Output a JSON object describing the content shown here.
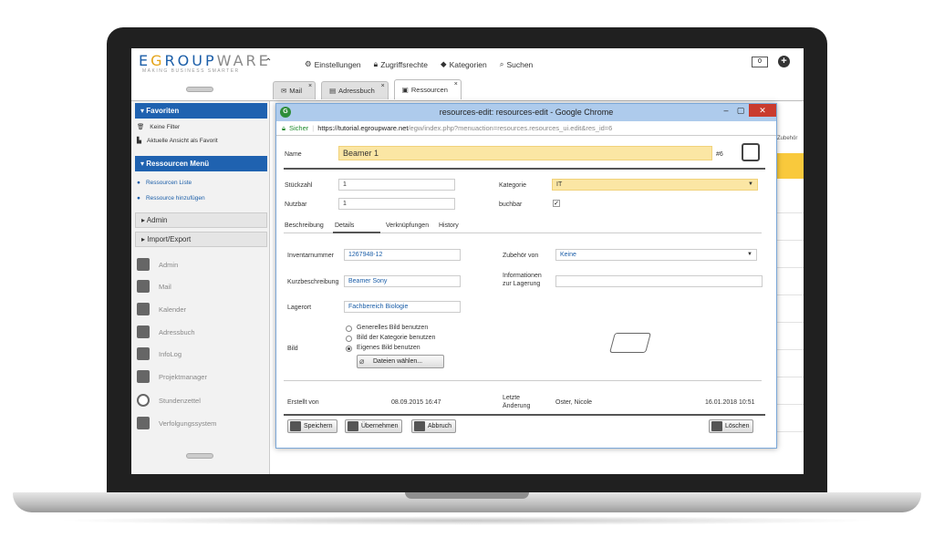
{
  "header": {
    "logo": "EGROUPWARE",
    "logo_sub": "MAKING BUSINESS SMARTER",
    "nav": [
      "Einstellungen",
      "Zugriffsrechte",
      "Kategorien",
      "Suchen"
    ],
    "counter": "0"
  },
  "tabs": [
    {
      "label": "Mail",
      "icon": "mail-icon"
    },
    {
      "label": "Adressbuch",
      "icon": "addressbook-icon"
    },
    {
      "label": "Ressourcen",
      "icon": "resources-icon",
      "active": true
    }
  ],
  "sidebar": {
    "favorites_title": "▾ Favoriten",
    "favorites": [
      "Keine Filter",
      "Aktuelle Ansicht als Favorit"
    ],
    "resources_title": "▾ Ressourcen Menü",
    "resources": [
      "Ressourcen Liste",
      "Ressource hinzufügen"
    ],
    "admin": "▸ Admin",
    "import_export": "▸ Import/Export",
    "apps": [
      "Admin",
      "Mail",
      "Kalender",
      "Adressbuch",
      "InfoLog",
      "Projektmanager",
      "Stundenzettel",
      "Verfolgungssystem"
    ]
  },
  "background": {
    "col_header": "Zubehör"
  },
  "popup": {
    "title": "resources-edit: resources-edit - Google Chrome",
    "url_secure": "Sicher",
    "url_domain": "https://tutorial.egroupware.net",
    "url_path": "/egw/index.php?menuaction=resources.resources_ui.edit&res_id=6",
    "name_label": "Name",
    "name_value": "Beamer 1",
    "id": "#6",
    "stueckzahl_label": "Stückzahl",
    "stueckzahl_value": "1",
    "nutzbar_label": "Nutzbar",
    "nutzbar_value": "1",
    "kategorie_label": "Kategorie",
    "kategorie_value": "IT",
    "buchbar_label": "buchbar",
    "subtabs": [
      "Beschreibung",
      "Details",
      "Verknüpfungen",
      "History"
    ],
    "inventar_label": "Inventarnummer",
    "inventar_value": "1267948-12",
    "kurz_label": "Kurzbeschreibung",
    "kurz_value": "Beamer Sony",
    "lagerort_label": "Lagerort",
    "lagerort_value": "Fachbereich Biologie",
    "zubehoer_label": "Zubehör von",
    "zubehoer_value": "Keine",
    "info_label_1": "Informationen",
    "info_label_2": "zur Lagerung",
    "bild_label": "Bild",
    "bild_options": [
      "Generelles Bild benutzen",
      "Bild der Kategorie benutzen",
      "Eigenes Bild benutzen"
    ],
    "file_button": "Dateien wählen...",
    "erstellt_label": "Erstellt von",
    "erstellt_value": "08.09.2015 16:47",
    "letzte_label_1": "Letzte",
    "letzte_label_2": "Änderung",
    "letzte_user": "Oster, Nicole",
    "letzte_value": "16.01.2018 10:51",
    "buttons": {
      "save": "Speichern",
      "apply": "Übernehmen",
      "cancel": "Abbruch",
      "delete": "Löschen"
    }
  }
}
